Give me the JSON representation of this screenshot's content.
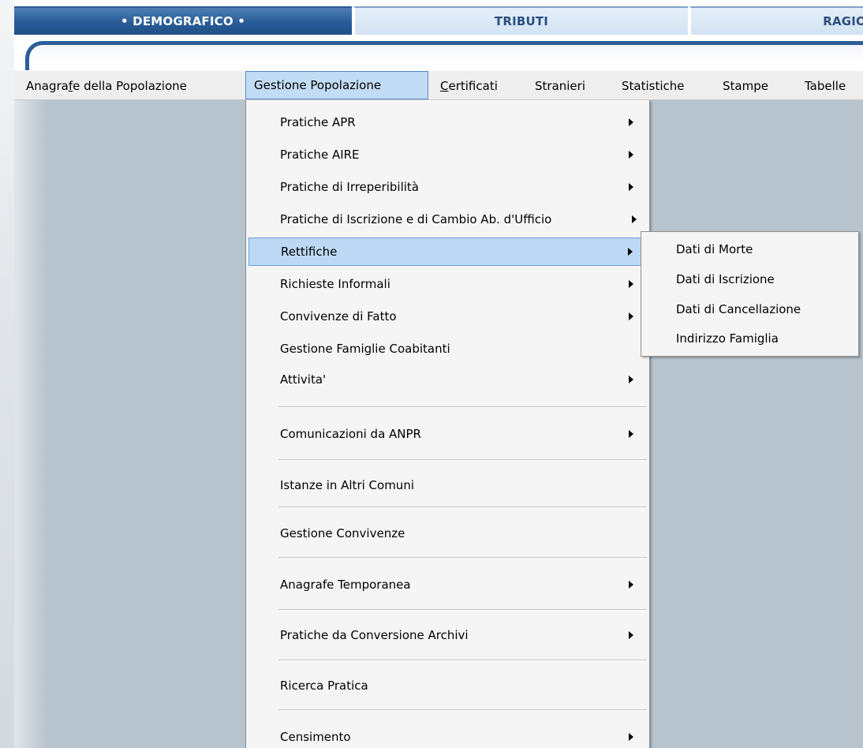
{
  "tabs": [
    {
      "label": "• DEMOGRAFICO •",
      "active": true
    },
    {
      "label": "TRIBUTI",
      "active": false
    },
    {
      "label": "RAGIO",
      "active": false
    }
  ],
  "menubar": {
    "items": [
      {
        "label_pre": "Anagra",
        "label_key": "f",
        "label_post": "e della Popolazione"
      },
      {
        "label": "Gestione Popolazione",
        "active": true
      },
      {
        "label_pre": "",
        "label_key": "C",
        "label_post": "ertificati"
      },
      {
        "label": "Stranieri"
      },
      {
        "label": "Statistiche"
      },
      {
        "label": "Stampe"
      },
      {
        "label": "Tabelle"
      }
    ]
  },
  "dropdown": {
    "items": [
      {
        "label": "Pratiche APR",
        "submenu": true
      },
      {
        "label": "Pratiche AIRE",
        "submenu": true
      },
      {
        "label": "Pratiche di Irreperibilità",
        "submenu": true
      },
      {
        "label": "Pratiche di Iscrizione e di Cambio Ab. d'Ufficio",
        "submenu": true
      },
      {
        "label": "Rettifiche",
        "submenu": true,
        "highlighted": true
      },
      {
        "label": "Richieste Informali",
        "submenu": true
      },
      {
        "label": "Convivenze di Fatto",
        "submenu": true
      },
      {
        "label": "Gestione Famiglie Coabitanti",
        "submenu": false
      },
      {
        "label": "Attivita'",
        "submenu": true
      },
      {
        "label": "Comunicazioni da ANPR",
        "submenu": true
      },
      {
        "label": "Istanze in Altri Comuni",
        "submenu": false
      },
      {
        "label": "Gestione Convivenze",
        "submenu": false
      },
      {
        "label": "Anagrafe Temporanea",
        "submenu": true
      },
      {
        "label": "Pratiche da Conversione Archivi",
        "submenu": true
      },
      {
        "label": "Ricerca Pratica",
        "submenu": false
      },
      {
        "label": "Censimento",
        "submenu": true
      }
    ]
  },
  "submenu": {
    "items": [
      {
        "label": "Dati di Morte"
      },
      {
        "label": "Dati di Iscrizione"
      },
      {
        "label": "Dati di Cancellazione"
      },
      {
        "label": "Indirizzo Famiglia"
      }
    ]
  }
}
